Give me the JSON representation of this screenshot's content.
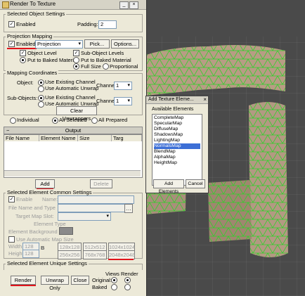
{
  "window": {
    "title": "Render To Texture"
  },
  "selected_object_settings": {
    "label": "Selected Object Settings",
    "enabled_label": "Enabled",
    "enabled_checked": true,
    "padding_label": "Padding:",
    "padding_value": "2"
  },
  "projection_mapping": {
    "label": "Projection Mapping",
    "enabled_label": "Enabled",
    "enabled_checked": true,
    "projection_value": "Projection",
    "pick_label": "Pick...",
    "options_label": "Options...",
    "object_level_label": "Object Level",
    "sub_object_levels_label": "Sub-Object Levels",
    "put_to_baked_material_label": "Put to Baked Material",
    "put_to_baked_material2_label": "Put to Baked Material",
    "full_size_label": "Full Size",
    "proportional_label": "Proportional"
  },
  "mapping_coordinates": {
    "label": "Mapping Coordinates",
    "object_label": "Object:",
    "sub_objects_label": "Sub-Objects:",
    "use_existing_channel": "Use Existing Channel",
    "use_automatic_unwrap": "Use Automatic Unwrap",
    "channel_label": "Channel",
    "object_channel": "1",
    "sub_channel": "1",
    "clear_unwrappers_label": "Clear Unwrappers"
  },
  "selection_mode": {
    "individual": "Individual",
    "all_selected": "All Selected",
    "all_prepared": "All Prepared"
  },
  "output": {
    "label": "Output",
    "columns": [
      "File Name",
      "Element Name",
      "Size",
      "Targ"
    ],
    "add_label": "Add",
    "delete_label": "Delete"
  },
  "element_common": {
    "label": "Selected Element Common Settings",
    "enable_label": "Enable",
    "name_label": "Name:",
    "file_name_type_label": "File Name and Type",
    "target_map_slot_label": "Target Map Slot:",
    "element_type_label": "Element Type",
    "element_background_label": "Element Background",
    "use_auto_map_size_label": "Use Automatic Map Size",
    "width_label": "Width",
    "height_label": "Height",
    "width_value": "128",
    "height_value": "128",
    "lock_label": "B",
    "sizes": [
      "128x128",
      "512x512",
      "1024x1024",
      "256x256",
      "768x768",
      "2048x2048"
    ]
  },
  "element_unique": {
    "label": "Selected Element Unique Settings"
  },
  "bottom": {
    "render_label": "Render",
    "unwrap_only_label": "Unwrap Only",
    "close_label": "Close",
    "original_label": "Original:",
    "baked_label": "Baked",
    "views_label": "Views",
    "render_col_label": "Render"
  },
  "add_texture_dialog": {
    "title": "Add Texture Eleme...",
    "available_label": "Available Elements",
    "items": [
      "CompleteMap",
      "SpecularMap",
      "DiffuseMap",
      "ShadowsMap",
      "LightingMap",
      "NormalsMap",
      "BlendMap",
      "AlphaMap",
      "HeightMap"
    ],
    "selected_index": 5,
    "add_elements_label": "Add Elements",
    "cancel_label": "Cancel"
  },
  "colors": {
    "highlight": "#e0141b",
    "selection": "#3d6fd6",
    "mesh_green": "#2fd12a"
  }
}
